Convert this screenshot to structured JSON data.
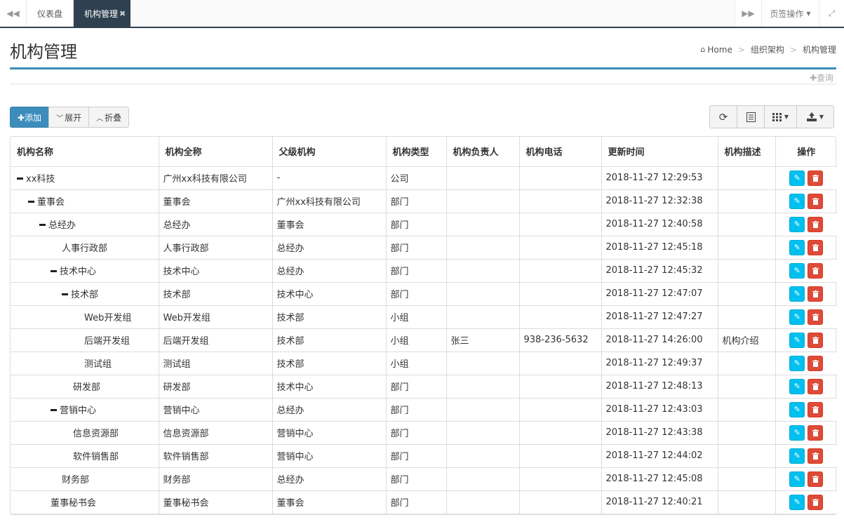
{
  "tabbar": {
    "tabs": [
      {
        "label": "仪表盘",
        "active": false
      },
      {
        "label": "机构管理",
        "active": true
      }
    ],
    "close_glyph": "✖",
    "ops_label": "页签操作"
  },
  "header": {
    "title": "机构管理",
    "breadcrumb": [
      "Home",
      "组织架构",
      "机构管理"
    ]
  },
  "search": {
    "toggle_label": "✚查询"
  },
  "toolbar": {
    "add_label": "✚添加",
    "expand_label": "展开",
    "collapse_label": "折叠"
  },
  "colors": {
    "primary": "#3c8dbc",
    "tab_active": "#2f4050",
    "edit": "#00c0ef",
    "delete": "#dd4b39"
  },
  "table": {
    "columns": [
      "机构名称",
      "机构全称",
      "父级机构",
      "机构类型",
      "机构负责人",
      "机构电话",
      "更新时间",
      "机构描述",
      "操作"
    ],
    "rows": [
      {
        "level": 0,
        "expanded": true,
        "name": "xx科技",
        "full": "广州xx科技有限公司",
        "parent": "-",
        "type": "公司",
        "leader": "",
        "phone": "",
        "time": "2018-11-27 12:29:53",
        "desc": ""
      },
      {
        "level": 1,
        "expanded": true,
        "name": "董事会",
        "full": "董事会",
        "parent": "广州xx科技有限公司",
        "type": "部门",
        "leader": "",
        "phone": "",
        "time": "2018-11-27 12:32:38",
        "desc": ""
      },
      {
        "level": 2,
        "expanded": true,
        "name": "总经办",
        "full": "总经办",
        "parent": "董事会",
        "type": "部门",
        "leader": "",
        "phone": "",
        "time": "2018-11-27 12:40:58",
        "desc": ""
      },
      {
        "level": 3,
        "expanded": false,
        "name": "人事行政部",
        "full": "人事行政部",
        "parent": "总经办",
        "type": "部门",
        "leader": "",
        "phone": "",
        "time": "2018-11-27 12:45:18",
        "desc": ""
      },
      {
        "level": 3,
        "expanded": true,
        "name": "技术中心",
        "full": "技术中心",
        "parent": "总经办",
        "type": "部门",
        "leader": "",
        "phone": "",
        "time": "2018-11-27 12:45:32",
        "desc": ""
      },
      {
        "level": 4,
        "expanded": true,
        "name": "技术部",
        "full": "技术部",
        "parent": "技术中心",
        "type": "部门",
        "leader": "",
        "phone": "",
        "time": "2018-11-27 12:47:07",
        "desc": ""
      },
      {
        "level": 5,
        "expanded": false,
        "name": "Web开发组",
        "full": "Web开发组",
        "parent": "技术部",
        "type": "小组",
        "leader": "",
        "phone": "",
        "time": "2018-11-27 12:47:27",
        "desc": ""
      },
      {
        "level": 5,
        "expanded": false,
        "name": "后端开发组",
        "full": "后端开发组",
        "parent": "技术部",
        "type": "小组",
        "leader": "张三",
        "phone": "938-236-5632",
        "time": "2018-11-27 14:26:00",
        "desc": "机构介绍"
      },
      {
        "level": 5,
        "expanded": false,
        "name": "测试组",
        "full": "测试组",
        "parent": "技术部",
        "type": "小组",
        "leader": "",
        "phone": "",
        "time": "2018-11-27 12:49:37",
        "desc": ""
      },
      {
        "level": 4,
        "expanded": false,
        "name": "研发部",
        "full": "研发部",
        "parent": "技术中心",
        "type": "部门",
        "leader": "",
        "phone": "",
        "time": "2018-11-27 12:48:13",
        "desc": ""
      },
      {
        "level": 3,
        "expanded": true,
        "name": "营销中心",
        "full": "营销中心",
        "parent": "总经办",
        "type": "部门",
        "leader": "",
        "phone": "",
        "time": "2018-11-27 12:43:03",
        "desc": ""
      },
      {
        "level": 4,
        "expanded": false,
        "name": "信息资源部",
        "full": "信息资源部",
        "parent": "营销中心",
        "type": "部门",
        "leader": "",
        "phone": "",
        "time": "2018-11-27 12:43:38",
        "desc": ""
      },
      {
        "level": 4,
        "expanded": false,
        "name": "软件销售部",
        "full": "软件销售部",
        "parent": "营销中心",
        "type": "部门",
        "leader": "",
        "phone": "",
        "time": "2018-11-27 12:44:02",
        "desc": ""
      },
      {
        "level": 3,
        "expanded": false,
        "name": "财务部",
        "full": "财务部",
        "parent": "总经办",
        "type": "部门",
        "leader": "",
        "phone": "",
        "time": "2018-11-27 12:45:08",
        "desc": ""
      },
      {
        "level": 2,
        "expanded": false,
        "name": "董事秘书会",
        "full": "董事秘书会",
        "parent": "董事会",
        "type": "部门",
        "leader": "",
        "phone": "",
        "time": "2018-11-27 12:40:21",
        "desc": ""
      }
    ]
  }
}
